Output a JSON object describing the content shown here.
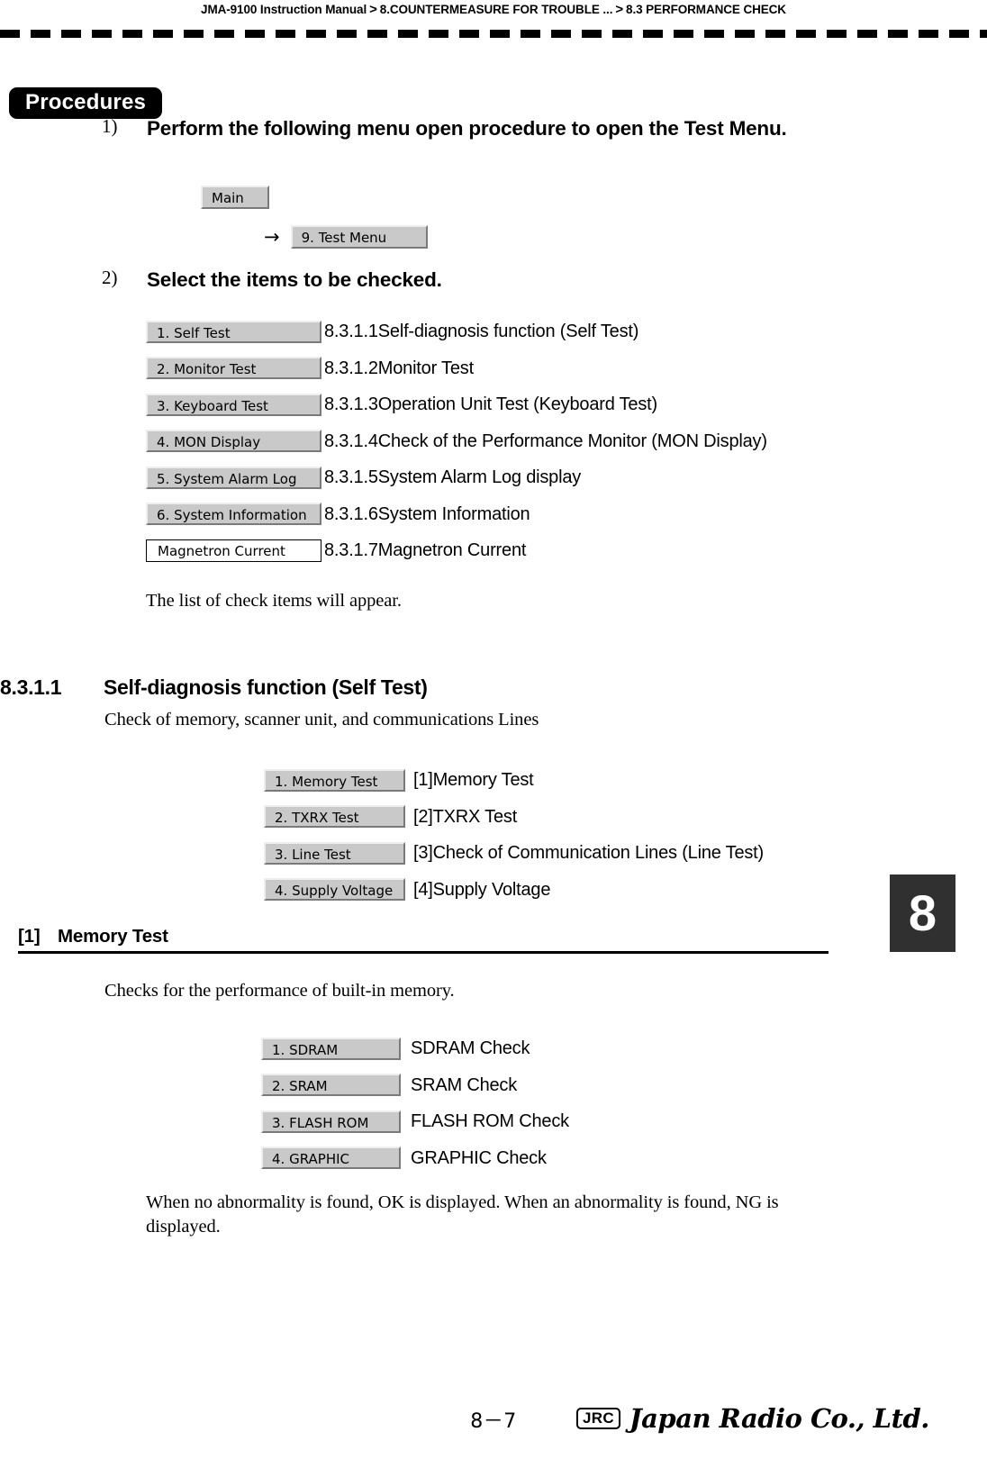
{
  "header": {
    "manual": "JMA-9100 Instruction Manual",
    "separator": ">",
    "crumb1": "8.COUNTERMEASURE FOR TROUBLE ...",
    "crumb2": "8.3  PERFORMANCE CHECK"
  },
  "procedures": {
    "badge": "Procedures",
    "steps": [
      {
        "num": "1)",
        "text": "Perform the following menu open procedure to open the Test Menu."
      },
      {
        "num": "2)",
        "text": "Select the items to be checked."
      }
    ],
    "path": {
      "main_button": "Main",
      "arrow": "→",
      "test_menu_button": "9. Test Menu"
    },
    "note": "The list of check items will appear."
  },
  "test_menu_items": [
    {
      "button": "1. Self Test",
      "desc": "8.3.1.1Self-diagnosis function (Self Test)",
      "style": "raised"
    },
    {
      "button": "2. Monitor Test",
      "desc": "8.3.1.2Monitor Test",
      "style": "raised"
    },
    {
      "button": "3. Keyboard Test",
      "desc": "8.3.1.3Operation Unit Test (Keyboard Test)",
      "style": "raised"
    },
    {
      "button": "4. MON Display",
      "desc": "8.3.1.4Check of the Performance Monitor (MON Display)",
      "style": "raised"
    },
    {
      "button": "5. System Alarm Log",
      "desc": "8.3.1.5System Alarm Log display",
      "style": "raised"
    },
    {
      "button": "6. System Information",
      "desc": "8.3.1.6System Information",
      "style": "raised"
    },
    {
      "button": "Magnetron Current",
      "desc": "8.3.1.7Magnetron Current",
      "style": "plain"
    }
  ],
  "section": {
    "number": "8.3.1.1",
    "title": "Self-diagnosis function (Self Test)",
    "intro": "Check of memory, scanner unit, and communications Lines"
  },
  "self_test_items": [
    {
      "button": "1. Memory Test",
      "desc": "[1]Memory Test"
    },
    {
      "button": "2. TXRX Test",
      "desc": "[2]TXRX Test"
    },
    {
      "button": "3. Line Test",
      "desc": "[3]Check of Communication Lines (Line Test)"
    },
    {
      "button": "4. Supply Voltage",
      "desc": "[4]Supply Voltage"
    }
  ],
  "subsection": {
    "number": "[1]",
    "title": "Memory Test",
    "intro": "Checks for the performance of built-in memory.",
    "outro": "When no abnormality is found, OK is displayed. When an abnormality is found, NG is displayed."
  },
  "memory_test_items": [
    {
      "button": "1. SDRAM",
      "desc": "SDRAM Check"
    },
    {
      "button": "2. SRAM",
      "desc": "SRAM Check"
    },
    {
      "button": "3. FLASH ROM",
      "desc": "FLASH ROM Check"
    },
    {
      "button": "4. GRAPHIC",
      "desc": "GRAPHIC Check"
    }
  ],
  "chapter_tab": "8",
  "footer": {
    "page": "8－7",
    "logo_mark": "JRC",
    "logo_text": "Japan Radio Co., Ltd."
  }
}
